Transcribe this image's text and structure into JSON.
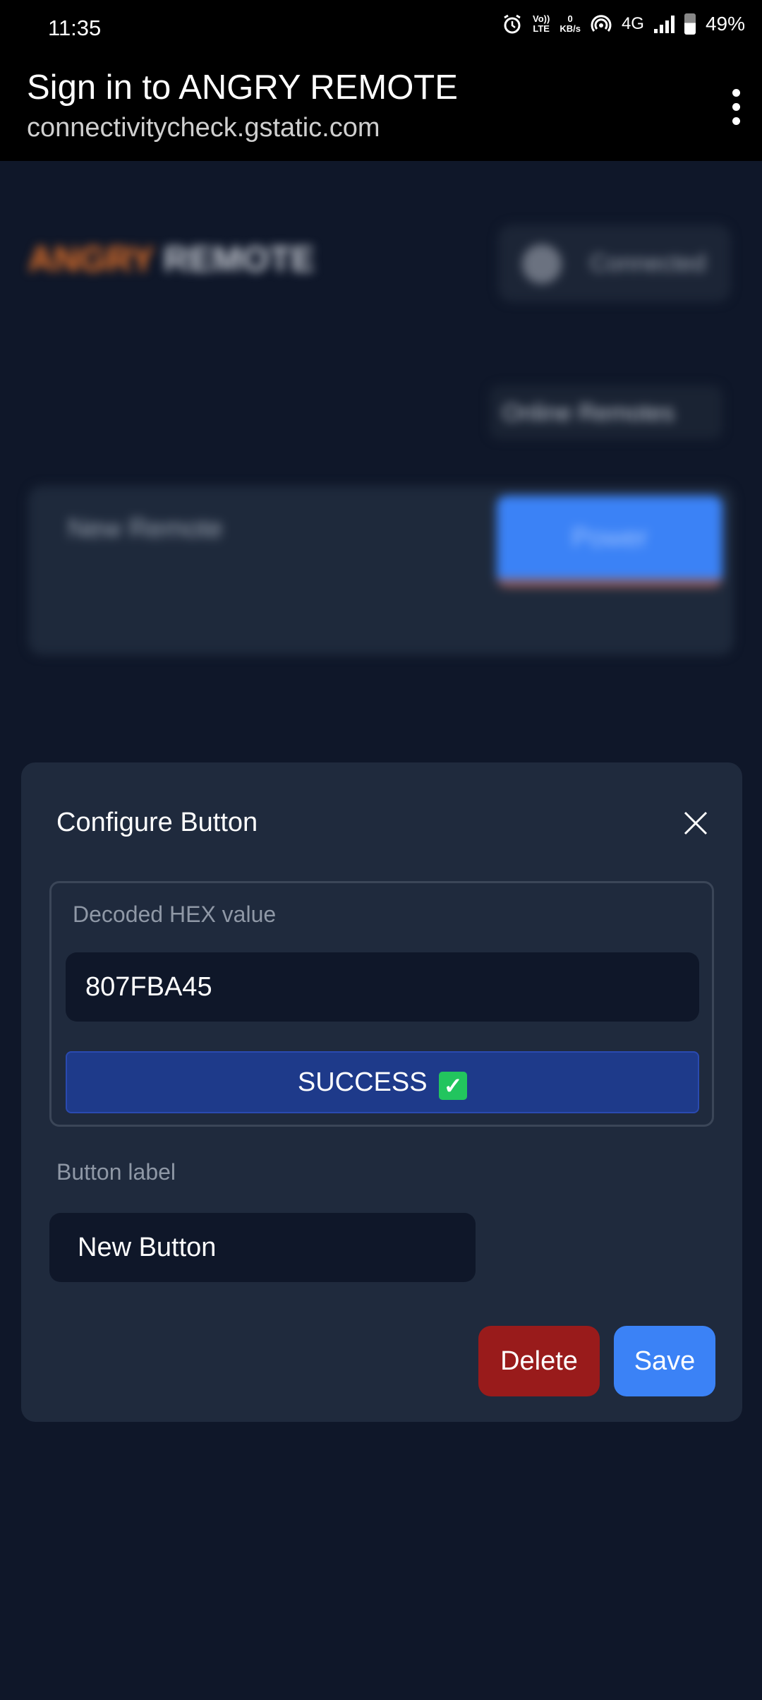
{
  "status_bar": {
    "time": "11:35",
    "volte_top": "Vo))",
    "volte_bottom": "LTE",
    "data_rate_value": "0",
    "data_rate_unit": "KB/s",
    "network": "4G",
    "battery_percent": "49%"
  },
  "browser": {
    "title": "Sign in to ANGRY REMOTE",
    "url": "connectivitycheck.gstatic.com"
  },
  "background_page": {
    "logo_part1": "ANGRY",
    "logo_part2": "REMOTE",
    "connection_status": "Connected",
    "remotes_select": "Online Remotes",
    "remote_name": "New Remote",
    "remote_action": "Power"
  },
  "modal": {
    "title": "Configure Button",
    "hex_label": "Decoded HEX value",
    "hex_value": "807FBA45",
    "status_text": "SUCCESS",
    "status_icon": "✓",
    "button_label_title": "Button label",
    "button_label_value": "New Button",
    "delete_label": "Delete",
    "save_label": "Save"
  },
  "colors": {
    "background": "#0f1729",
    "modal": "#1f2a3d",
    "success": "#1e3a8a",
    "delete": "#991b1b",
    "save": "#3b82f6",
    "logo_accent": "#e8742a"
  }
}
